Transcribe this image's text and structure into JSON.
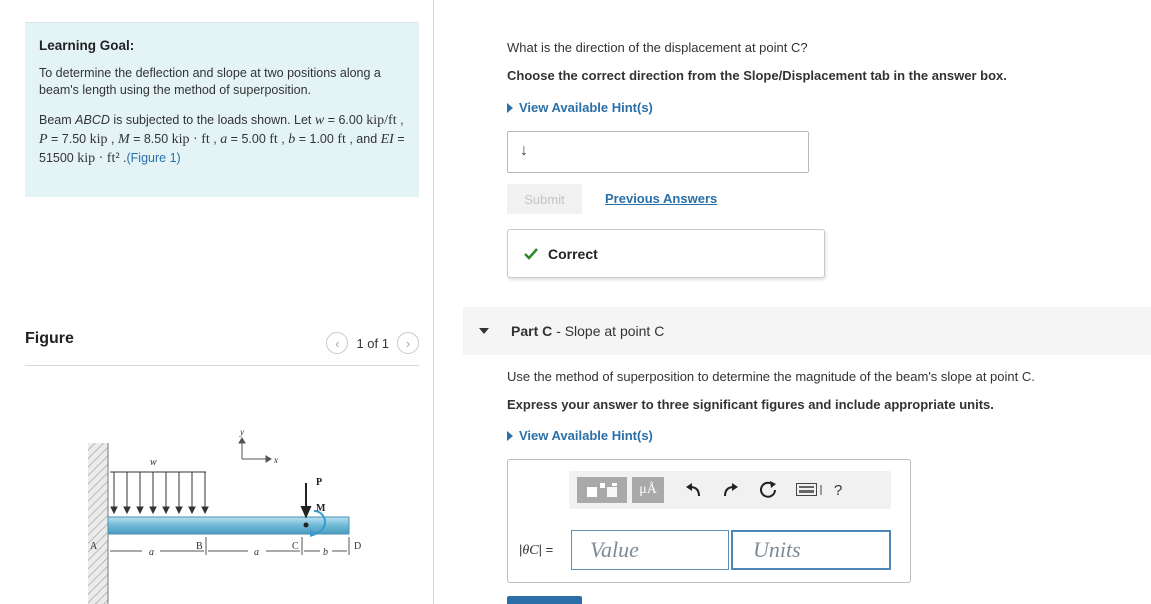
{
  "learning_goal": {
    "title": "Learning Goal:",
    "description": "To determine the deflection and slope at two positions along a beam's length using the method of superposition.",
    "beam_prefix": "Beam ",
    "beam_name": "ABCD",
    "beam_mid": " is subjected to the loads shown. Let ",
    "w_sym": "w",
    "w_val": " = 6.00 ",
    "w_unit": "kip/ft",
    "p_sep": " , ",
    "p_sym": "P",
    "p_val": " = 7.50 ",
    "p_unit": "kip",
    "m_sep": " , ",
    "m_sym": "M",
    "m_val": " = 8.50 ",
    "m_unit": "kip · ft",
    "a_sep": " , ",
    "a_sym": "a",
    "a_val": " = 5.00 ",
    "a_unit": "ft",
    "b_sep": " , ",
    "b_sym": "b",
    "b_val": " = 1.00 ",
    "b_unit": "ft",
    "ei_sep": " , and ",
    "ei_sym": "EI",
    "ei_val": " = 51500 ",
    "ei_unit": "kip · ft²",
    "end": " .",
    "figure_link": "(Figure 1)"
  },
  "figure": {
    "title": "Figure",
    "pager_text": "1 of 1",
    "labels": {
      "w": "w",
      "y": "y",
      "x": "x",
      "P": "P",
      "M": "M",
      "A": "A",
      "B": "B",
      "C": "C",
      "D": "D",
      "a1": "a",
      "a2": "a",
      "b": "b"
    }
  },
  "part_b": {
    "question": "What is the direction of the displacement at point C?",
    "instruction": "Choose the correct direction from the Slope/Displacement tab in the answer box.",
    "hint_label": "View Available Hint(s)",
    "answer_glyph": "↓",
    "submit_label": "Submit",
    "previous_answers": "Previous Answers",
    "result": "Correct"
  },
  "part_c": {
    "prefix": "Part C",
    "sep": " - ",
    "title": "Slope at point C",
    "question": "Use the method of superposition to determine the magnitude of the beam's slope at point C.",
    "instruction": "Express your answer to three significant figures and include appropriate units.",
    "hint_label": "View Available Hint(s)",
    "toolbar": {
      "units_button": "μÅ",
      "help": "?"
    },
    "eq_label_prefix": "|",
    "eq_label_sym": "θC",
    "eq_label_suffix": "| =",
    "value_placeholder": "Value",
    "units_placeholder": "Units"
  },
  "colors": {
    "accent": "#2a6fa8",
    "goal_bg": "#e4f4f6",
    "correct_green": "#2e8b2e",
    "beam_fill": "#7ec4de"
  },
  "icons": [
    "chevron-left-icon",
    "chevron-right-icon",
    "checkmark-icon",
    "undo-icon",
    "redo-icon",
    "reset-icon",
    "keyboard-icon",
    "help-icon",
    "caret-down-icon",
    "hint-caret-icon"
  ]
}
